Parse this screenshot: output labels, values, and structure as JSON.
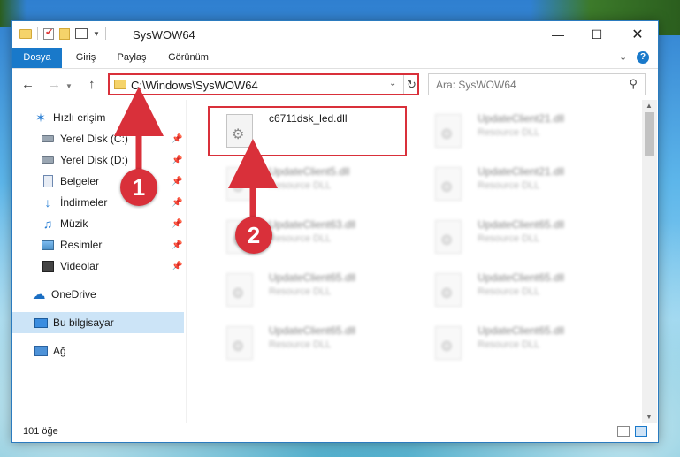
{
  "window": {
    "title": "SysWOW64",
    "controls": {
      "minimize": "—",
      "maximize": "☐",
      "close": "✕"
    }
  },
  "ribbon": {
    "tabs": [
      "Dosya",
      "Giriş",
      "Paylaş",
      "Görünüm"
    ],
    "help": "?"
  },
  "nav": {
    "back": "←",
    "forward": "→",
    "up": "↑",
    "address": "C:\\Windows\\SysWOW64",
    "search_placeholder": "Ara: SysWOW64"
  },
  "sidebar": {
    "items": [
      {
        "label": "Hızlı erişim",
        "icon": "star-icon"
      },
      {
        "label": "Yerel Disk (C:)",
        "icon": "disk-icon",
        "pinned": true
      },
      {
        "label": "Yerel Disk (D:)",
        "icon": "disk-icon",
        "pinned": true
      },
      {
        "label": "Belgeler",
        "icon": "document-icon",
        "pinned": true
      },
      {
        "label": "İndirmeler",
        "icon": "download-icon",
        "pinned": true
      },
      {
        "label": "Müzik",
        "icon": "music-icon",
        "pinned": true
      },
      {
        "label": "Resimler",
        "icon": "pictures-icon",
        "pinned": true
      },
      {
        "label": "Videolar",
        "icon": "video-icon",
        "pinned": true
      },
      {
        "label": "OneDrive",
        "icon": "cloud-icon"
      },
      {
        "label": "Bu bilgisayar",
        "icon": "computer-icon",
        "selected": true
      },
      {
        "label": "Ağ",
        "icon": "network-icon"
      }
    ]
  },
  "files": {
    "highlighted": {
      "name": "c6711dsk_led.dll"
    },
    "others": [
      {
        "name": "UpdateClient21.dll",
        "type": "Resource DLL"
      },
      {
        "name": "UpdateClient5.dll",
        "type": "Resource DLL"
      },
      {
        "name": "UpdateClient21.dll",
        "type": "Resource DLL"
      },
      {
        "name": "UpdateClient63.dll",
        "type": "Resource DLL"
      },
      {
        "name": "UpdateClient65.dll",
        "type": "Resource DLL"
      },
      {
        "name": "UpdateClient65.dll",
        "type": "Resource DLL"
      },
      {
        "name": "UpdateClient65.dll",
        "type": "Resource DLL"
      },
      {
        "name": "UpdateClient65.dll",
        "type": "Resource DLL"
      },
      {
        "name": "UpdateClient65.dll",
        "type": "Resource DLL"
      }
    ]
  },
  "status": {
    "count": "101 öğe"
  },
  "annotations": {
    "step1": "1",
    "step2": "2",
    "color": "#d9303a"
  }
}
